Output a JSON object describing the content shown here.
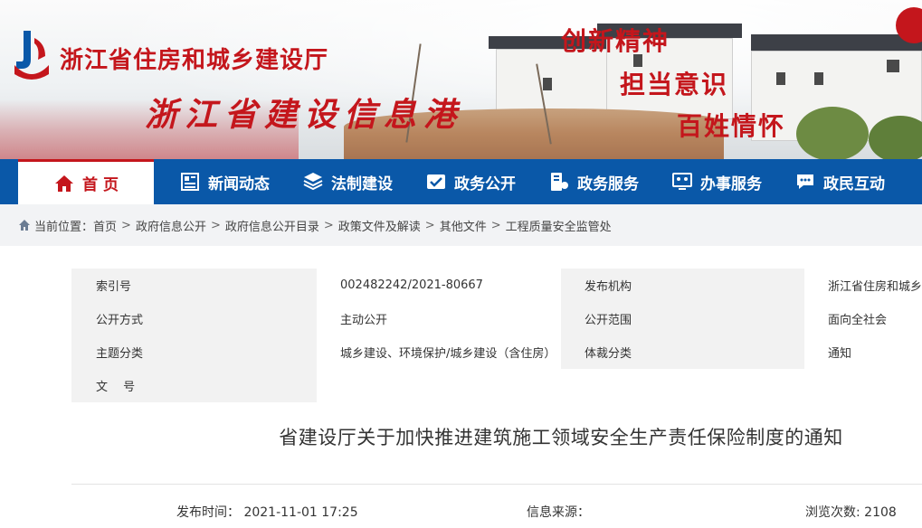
{
  "header": {
    "org_name": "浙江省住房和城乡建设厅",
    "portal_name": "浙江省建设信息港",
    "slogans": [
      "创新精神",
      "担当意识",
      "百姓情怀"
    ]
  },
  "nav": {
    "items": [
      {
        "label": "首 页",
        "icon": "home-icon"
      },
      {
        "label": "新闻动态",
        "icon": "news-icon"
      },
      {
        "label": "法制建设",
        "icon": "law-icon"
      },
      {
        "label": "政务公开",
        "icon": "gov-open-icon"
      },
      {
        "label": "政务服务",
        "icon": "gov-service-icon"
      },
      {
        "label": "办事服务",
        "icon": "office-service-icon"
      },
      {
        "label": "政民互动",
        "icon": "interaction-icon"
      }
    ]
  },
  "breadcrumb": {
    "prefix": "当前位置：",
    "items": [
      "首页",
      "政府信息公开",
      "政府信息公开目录",
      "政策文件及解读",
      "其他文件",
      "工程质量安全监管处"
    ],
    "separator": ">"
  },
  "meta": {
    "rows": [
      {
        "label1": "索引号",
        "value1": "002482242/2021-80667",
        "label2": "发布机构",
        "value2": "浙江省住房和城乡建设厅"
      },
      {
        "label1": "公开方式",
        "value1": "主动公开",
        "label2": "公开范围",
        "value2": "面向全社会"
      },
      {
        "label1": "主题分类",
        "value1": "城乡建设、环境保护/城乡建设（含住房）",
        "label2": "体裁分类",
        "value2": "通知"
      },
      {
        "label1": "文　 号",
        "value1": "",
        "label2": "",
        "value2": ""
      }
    ]
  },
  "article": {
    "title": "省建设厅关于加快推进建筑施工领域安全生产责任保险制度的通知",
    "publish_label": "发布时间：",
    "publish_time": "2021-11-01 17:25",
    "source_label": "信息来源：",
    "source_value": "",
    "views_label": "浏览次数:",
    "views": "2108"
  },
  "colors": {
    "brand_red": "#c4161c",
    "nav_blue": "#0a58a8",
    "meta_gray": "#f2f2f2"
  }
}
